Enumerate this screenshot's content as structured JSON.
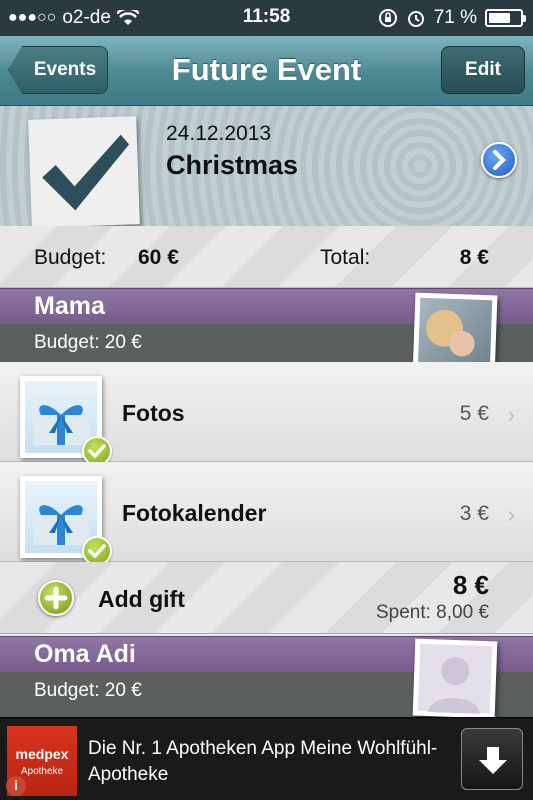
{
  "status_bar": {
    "signal": "●●●○○",
    "carrier": "o2-de",
    "time": "11:58",
    "battery_percent": "71 %",
    "battery_level": 0.71,
    "icons": [
      "wifi-icon",
      "rotation-lock-icon",
      "alarm-icon",
      "battery-icon"
    ]
  },
  "nav": {
    "back_label": "Events",
    "title": "Future Event",
    "edit_label": "Edit"
  },
  "event": {
    "date": "24.12.2013",
    "name": "Christmas",
    "icon": "checkmark-icon"
  },
  "summary": {
    "budget_label": "Budget:",
    "budget_value": "60 €",
    "total_label": "Total:",
    "total_value": "8 €"
  },
  "persons": [
    {
      "name": "Mama",
      "budget": "Budget: 20 €",
      "gifts": [
        {
          "name": "Fotos",
          "price": "5 €"
        },
        {
          "name": "Fotokalender",
          "price": "3 €"
        }
      ],
      "add_gift_label": "Add gift",
      "total": "8 €",
      "spent": "Spent: 8,00 €"
    },
    {
      "name": "Oma Adi",
      "budget": "Budget: 20 €"
    }
  ],
  "ad": {
    "brand": "medpex",
    "brand_sub": "Apotheke",
    "text": "Die Nr. 1 Apotheken App Meine Wohlfühl-Apotheke",
    "download_icon": "download-arrow-icon",
    "info_icon": "info-icon"
  },
  "colors": {
    "nav_teal": "#4b8891",
    "person_purple": "#765b8c",
    "check_green": "#7aa61f",
    "disclosure_blue": "#1e5fc2",
    "ad_red": "#c1280f"
  }
}
